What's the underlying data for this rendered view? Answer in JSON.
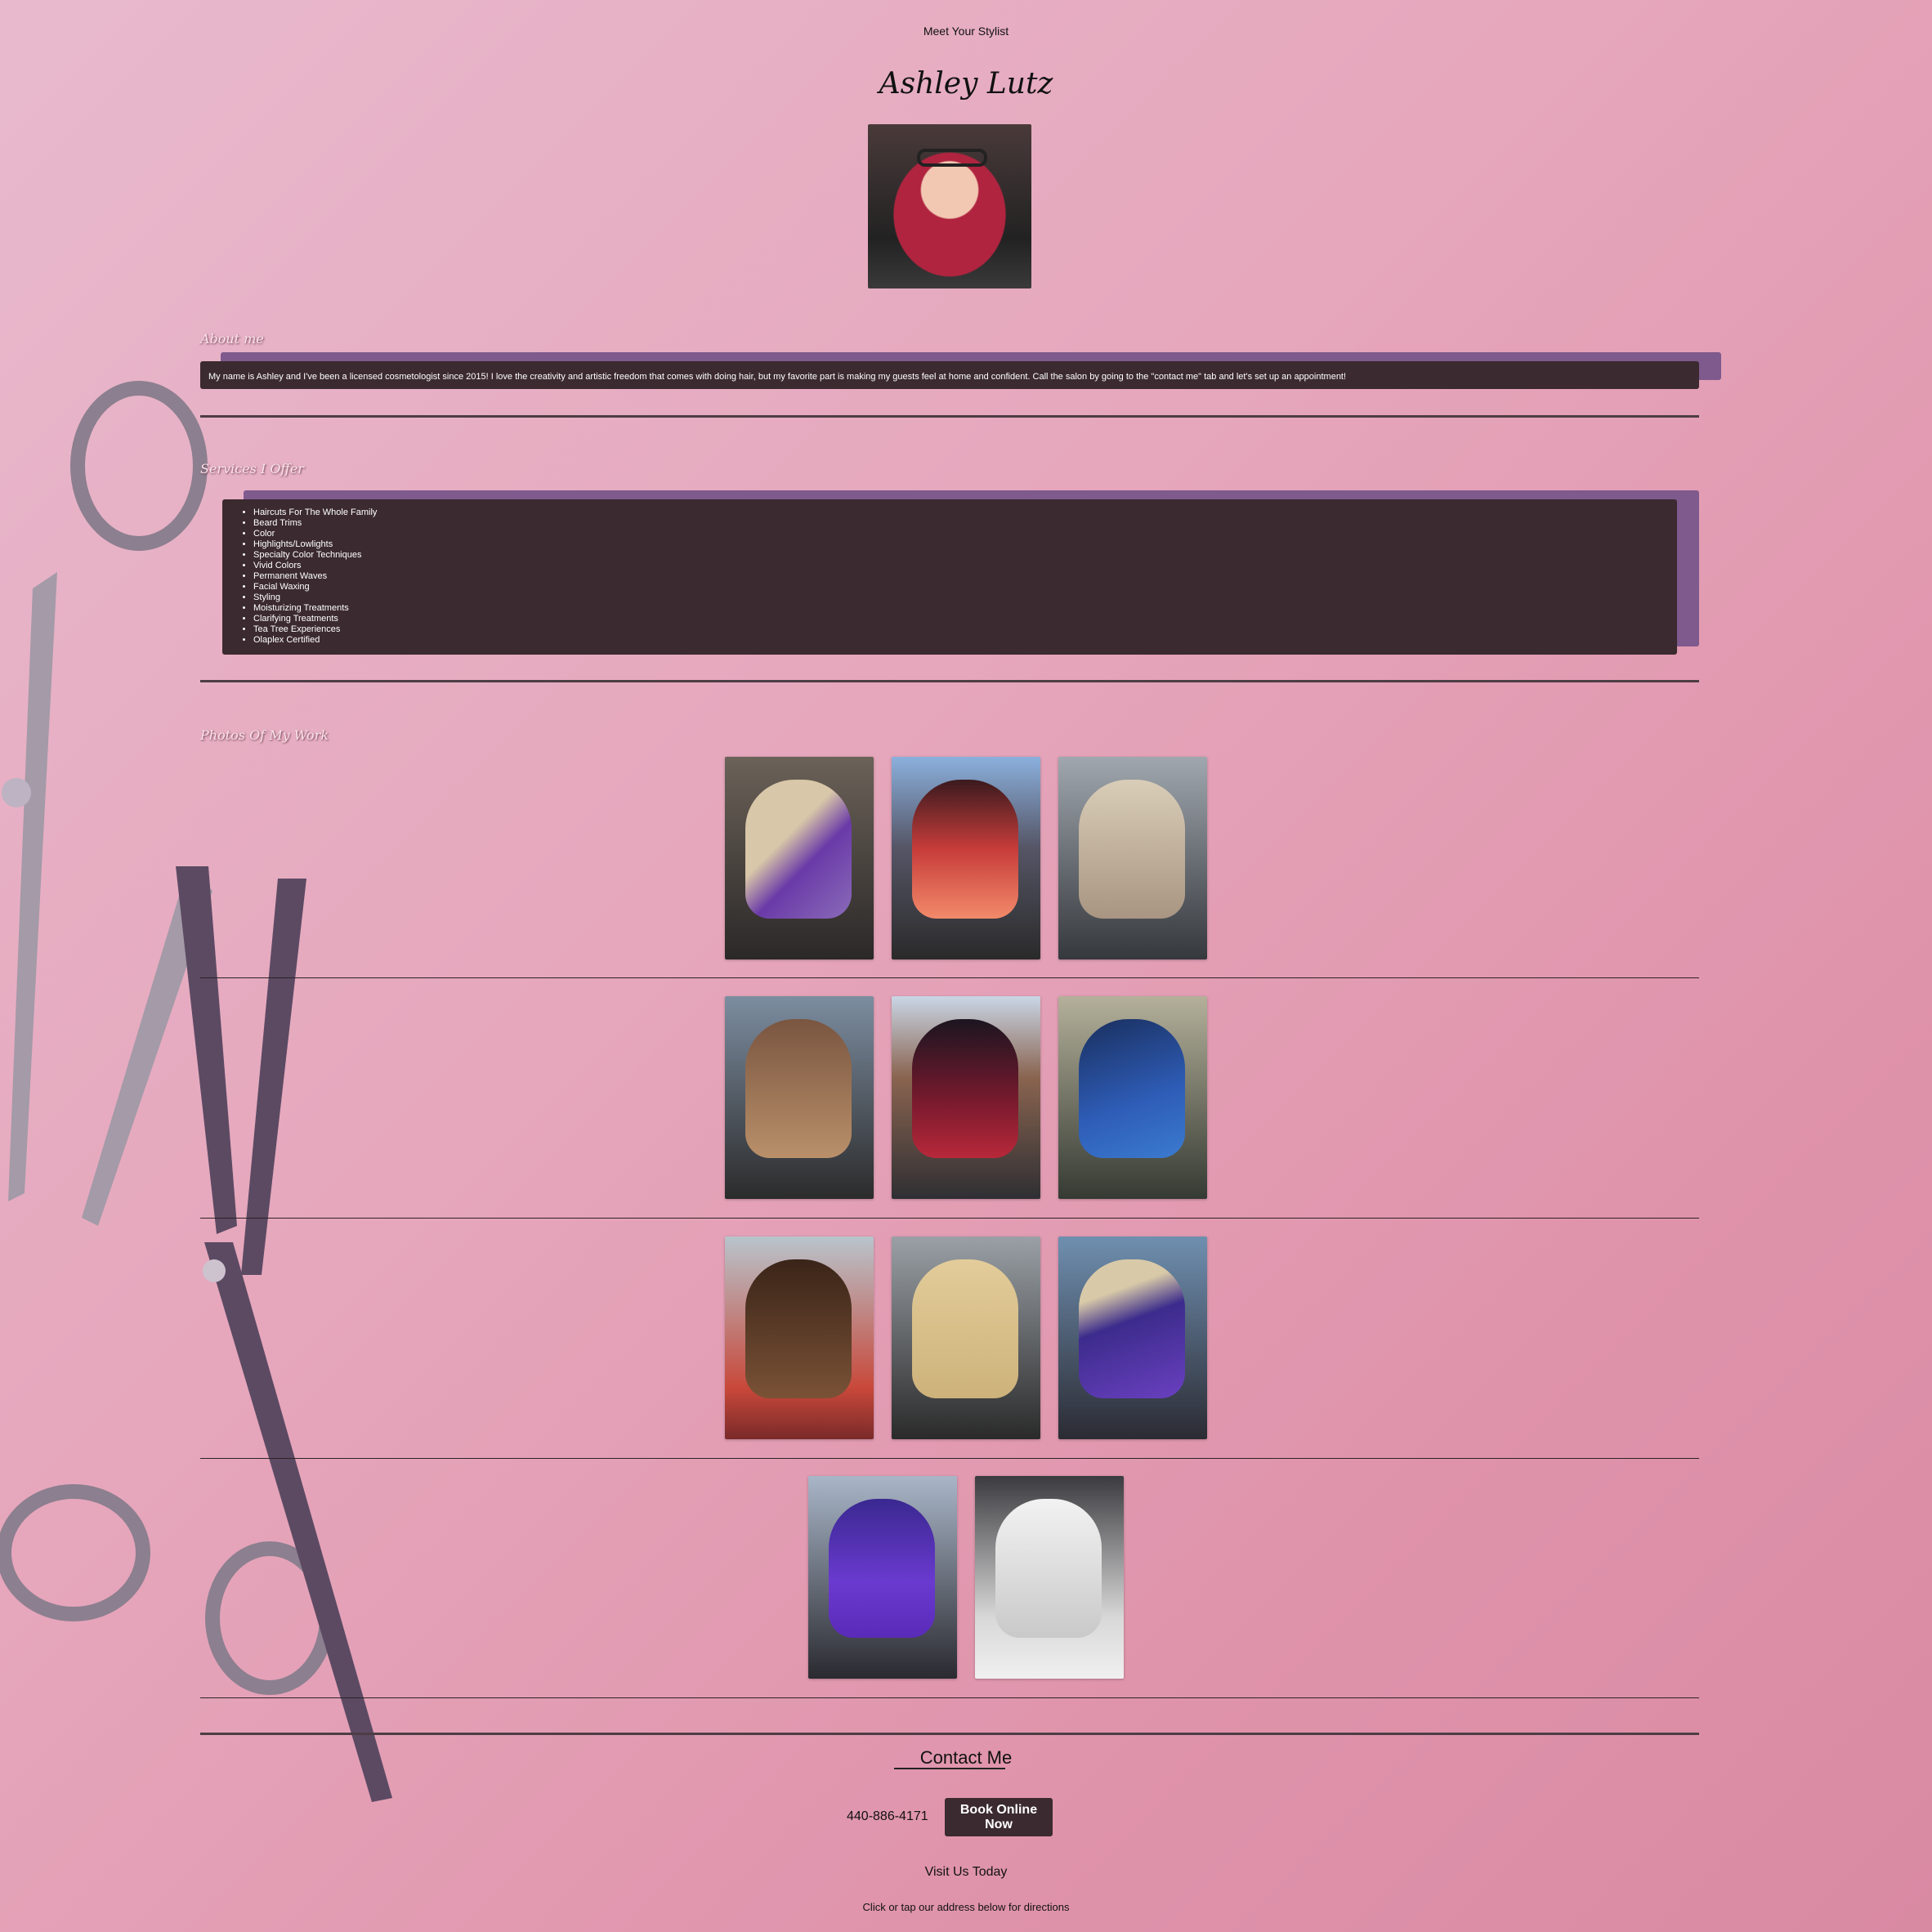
{
  "header": {
    "kicker": "Meet Your Stylist",
    "stylist_name": "Ashley Lutz"
  },
  "about": {
    "title": "About me",
    "text": "My name is Ashley and I've been a licensed cosmetologist since 2015! I love the creativity and artistic freedom that comes with doing hair, but my favorite part is making my guests feel at home and confident. Call the salon by going to the \"contact me\" tab and let's set up an appointment!"
  },
  "services": {
    "title": "Services I Offer",
    "items": [
      "Haircuts For The Whole Family",
      "Beard Trims",
      "Color",
      "Highlights/Lowlights",
      "Specialty Color Techniques",
      "Vivid Colors",
      "Permanent Waves",
      "Facial Waxing",
      "Styling",
      "Moisturizing Treatments",
      "Clarifying Treatments",
      "Tea Tree Experiences",
      "Olaplex Certified"
    ]
  },
  "gallery": {
    "title": "Photos Of My Work"
  },
  "contact": {
    "title": "Contact Me",
    "phone": "440-886-4171",
    "book_label": "Book Online Now",
    "visit": "Visit Us Today",
    "directions": "Click or tap our address below for directions"
  }
}
